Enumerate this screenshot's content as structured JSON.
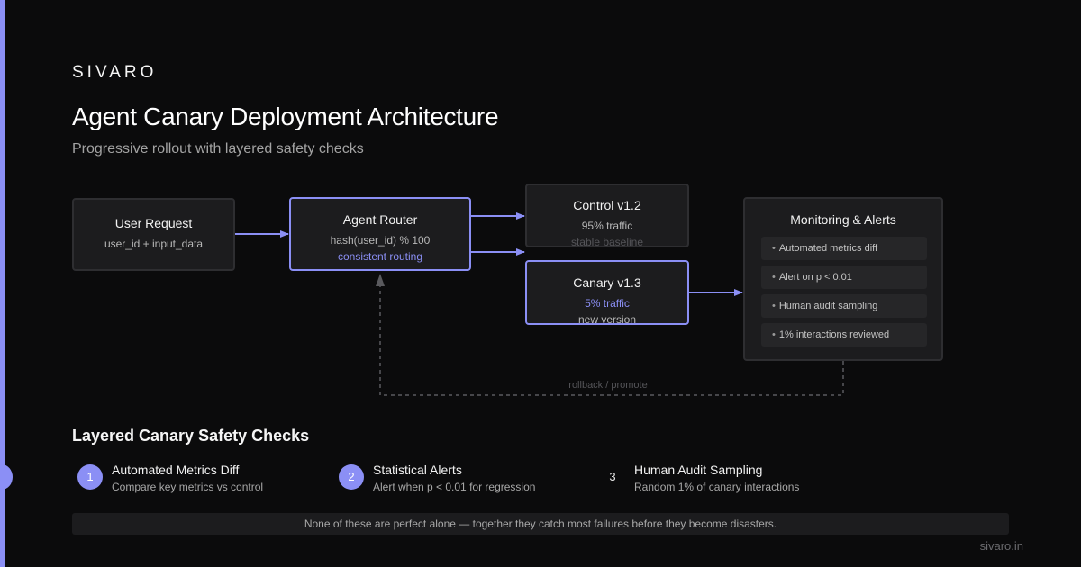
{
  "brand": "SIVARO",
  "title": "Agent Canary Deployment Architecture",
  "subtitle": "Progressive rollout with layered safety checks",
  "nodes": {
    "user_request": {
      "title": "User Request",
      "detail": "user_id + input_data"
    },
    "router": {
      "title": "Agent Router",
      "detail": "hash(user_id) % 100",
      "note": "consistent routing"
    },
    "control": {
      "title": "Control v1.2",
      "traffic": "95% traffic",
      "note": "stable baseline"
    },
    "canary": {
      "title": "Canary v1.3",
      "traffic": "5% traffic",
      "note": "new version"
    },
    "monitoring": {
      "title": "Monitoring & Alerts",
      "items": [
        "Automated metrics diff",
        "Alert on p < 0.01",
        "Human audit sampling",
        "1% interactions reviewed"
      ]
    }
  },
  "feedback_label": "rollback / promote",
  "safety": {
    "title": "Layered Canary Safety Checks",
    "checks": [
      {
        "num": "1",
        "title": "Automated Metrics Diff",
        "desc": "Compare key metrics vs control"
      },
      {
        "num": "2",
        "title": "Statistical Alerts",
        "desc": "Alert when p < 0.01 for regression"
      },
      {
        "num": "3",
        "title": "Human Audit Sampling",
        "desc": "Random 1% of canary interactions"
      }
    ]
  },
  "footer_note": "None of these are perfect alone — together they catch most failures before they become disasters.",
  "site": "sivaro.in",
  "colors": {
    "accent": "#8b8ff5",
    "background": "#0b0b0c",
    "node": "#1c1c1e",
    "border": "#2e2e31"
  }
}
